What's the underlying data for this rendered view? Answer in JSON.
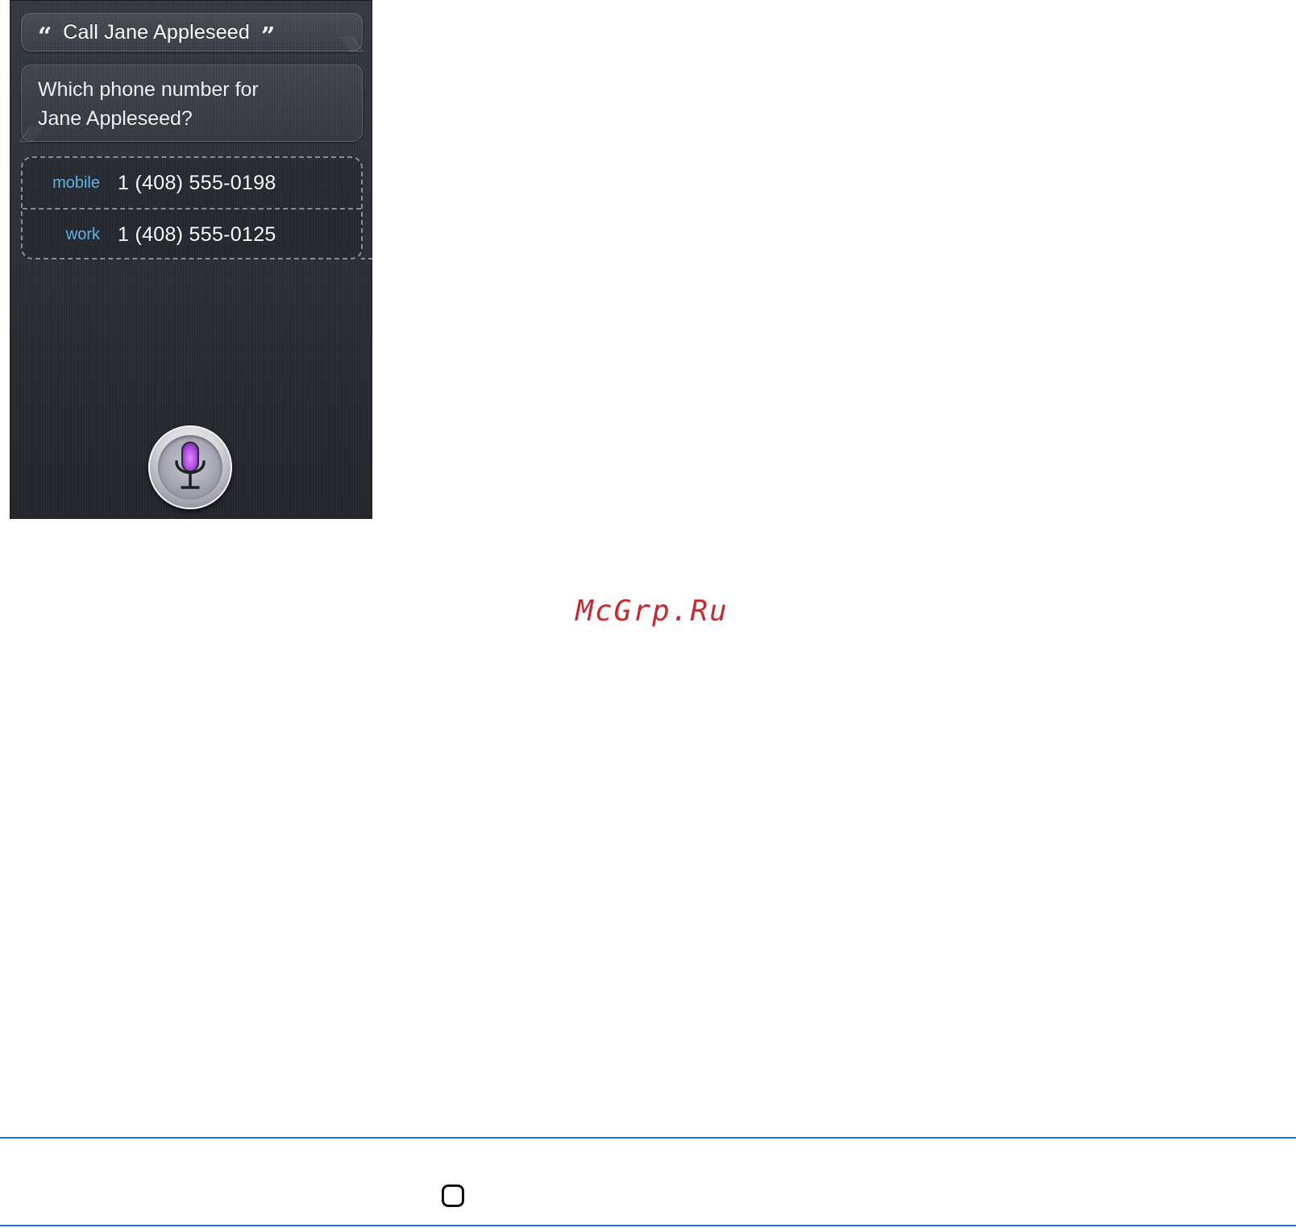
{
  "siri": {
    "user_request": "Call Jane Appleseed",
    "open_quote": "“",
    "close_quote": "”",
    "reply": "Which phone number for Jane Appleseed?",
    "numbers": [
      {
        "label": "mobile",
        "value": "1 (408) 555-0198"
      },
      {
        "label": "work",
        "value": "1 (408) 555-0125"
      }
    ],
    "mic_icon": "microphone-icon",
    "label_color": "#5fb3e8",
    "mic_glow_color": "#b14de0"
  },
  "watermark": {
    "text": "McGrp.Ru",
    "color": "#c8282e"
  },
  "footer": {
    "rule_color": "#1b74c5",
    "icon": "home-button-icon"
  }
}
